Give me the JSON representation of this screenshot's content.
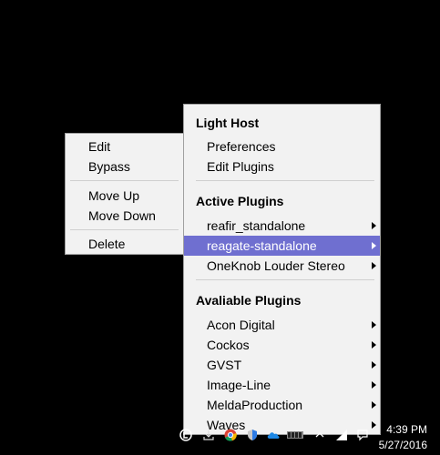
{
  "context_menu": {
    "items": [
      {
        "label": "Edit"
      },
      {
        "label": "Bypass"
      },
      {
        "label": "Move Up"
      },
      {
        "label": "Move Down"
      },
      {
        "label": "Delete"
      }
    ]
  },
  "main_menu": {
    "header_light_host": "Light Host",
    "preferences_label": "Preferences",
    "edit_plugins_label": "Edit Plugins",
    "header_active": "Active Plugins",
    "active_plugins": [
      {
        "label": "reafir_standalone"
      },
      {
        "label": "reagate-standalone",
        "highlighted": true
      },
      {
        "label": "OneKnob Louder Stereo"
      }
    ],
    "header_available": "Avaliable Plugins",
    "available_plugins": [
      {
        "label": "Acon Digital"
      },
      {
        "label": "Cockos"
      },
      {
        "label": "GVST"
      },
      {
        "label": "Image-Line"
      },
      {
        "label": "MeldaProduction"
      },
      {
        "label": "Waves"
      }
    ],
    "highlight_color": "#6f6fd0"
  },
  "taskbar": {
    "time": "4:39 PM",
    "date": "5/27/2016",
    "tray_icons": [
      "light-host-icon",
      "download-icon",
      "chrome-icon",
      "shield-icon",
      "cloud-icon",
      "battery-meter-icon",
      "chevron-up-icon",
      "network-icon",
      "notifications-icon"
    ]
  }
}
